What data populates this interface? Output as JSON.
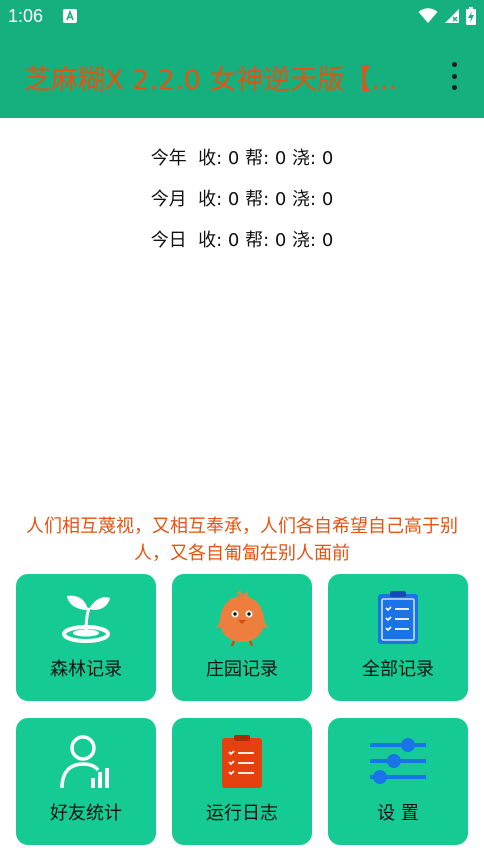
{
  "status_bar": {
    "time": "1:06",
    "notification_icon": "a-app-icon",
    "wifi_icon": "wifi-icon",
    "signal_icon": "signal-no-service-icon",
    "battery_icon": "battery-charging-icon"
  },
  "app_bar": {
    "title": "芝麻糊X 2.2.0 女神逆天版【...",
    "menu_icon": "more-vert-icon"
  },
  "stats": [
    {
      "period": "今年",
      "text": "收: 0 帮: 0 浇: 0"
    },
    {
      "period": "今月",
      "text": "收: 0 帮: 0 浇: 0"
    },
    {
      "period": "今日",
      "text": "收: 0 帮: 0 浇: 0"
    }
  ],
  "quote": "人们相互蔑视，又相互奉承，人们各自希望自己高于别人，又各自匍匐在别人面前",
  "tiles": [
    {
      "label": "森林记录",
      "icon": "sprout-icon"
    },
    {
      "label": "庄园记录",
      "icon": "chick-icon"
    },
    {
      "label": "全部记录",
      "icon": "clipboard-checklist-icon"
    },
    {
      "label": "好友统计",
      "icon": "user-stats-icon"
    },
    {
      "label": "运行日志",
      "icon": "log-clipboard-icon"
    },
    {
      "label": "设 置",
      "icon": "sliders-icon"
    }
  ],
  "colors": {
    "primary": "#16b07f",
    "tile": "#16cb93",
    "accent": "#e25412",
    "icon_blue": "#1a73e8"
  }
}
